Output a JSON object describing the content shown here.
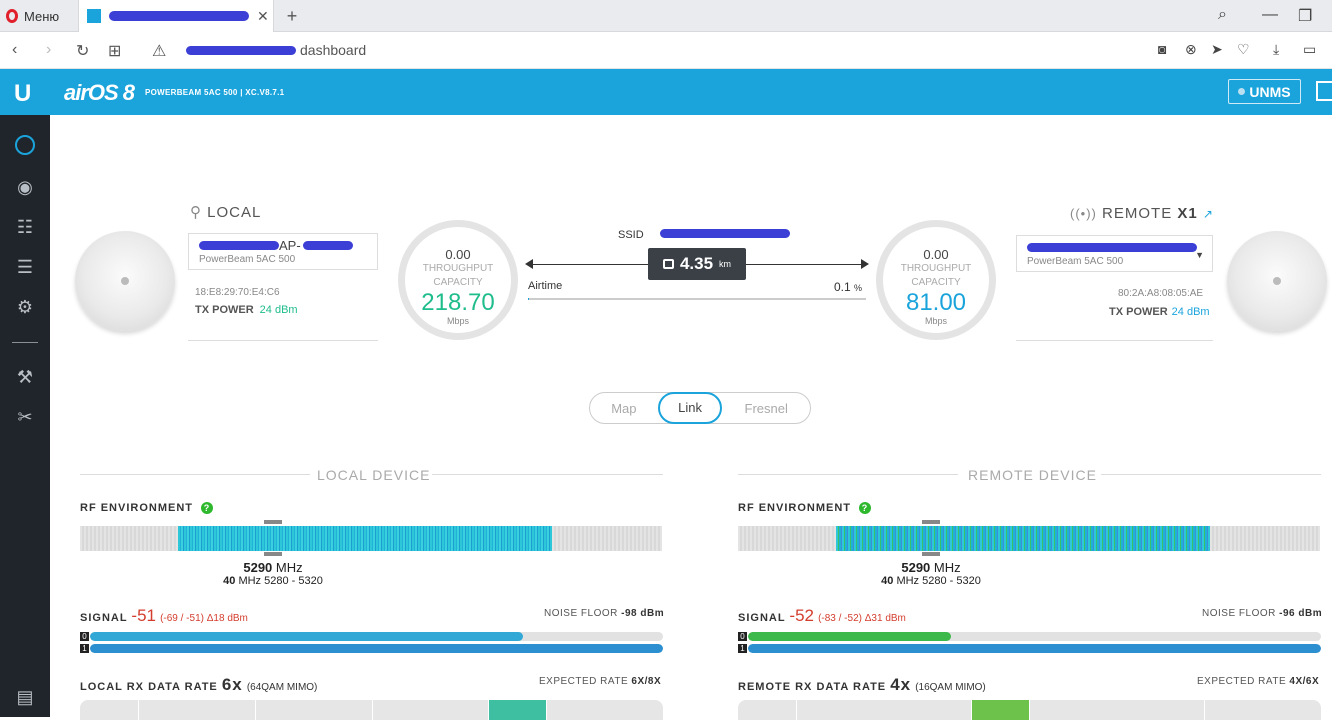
{
  "browser": {
    "menu_label": "Меню",
    "url_suffix": "dashboard"
  },
  "header": {
    "logo": "U",
    "brand": "airOS 8",
    "device_info": "POWERBEAM 5AC 500 | XC.V8.7.1",
    "unms_label": "UNMS"
  },
  "sidebar": {
    "items": [
      "dashboard",
      "wireless",
      "network",
      "services",
      "system",
      "tools",
      "utilities",
      "log"
    ]
  },
  "local": {
    "title": "LOCAL",
    "name": "AP-",
    "model": "PowerBeam 5AC 500",
    "mac": "18:E8:29:70:E4:C6",
    "tx_power_label": "TX POWER",
    "tx_power": "24 dBm"
  },
  "remote": {
    "title": "REMOTE",
    "count": "X1",
    "model": "PowerBeam 5AC 500",
    "mac": "80:2A:A8:08:05:AE",
    "tx_power_label": "TX POWER",
    "tx_power": "24 dBm"
  },
  "local_gauge": {
    "throughput": "0.00",
    "label1": "THROUGHPUT",
    "label2": "CAPACITY",
    "capacity": "218.70",
    "unit": "Mbps"
  },
  "remote_gauge": {
    "throughput": "0.00",
    "label1": "THROUGHPUT",
    "label2": "CAPACITY",
    "capacity": "81.00",
    "unit": "Mbps"
  },
  "link": {
    "ssid_label": "SSID",
    "distance": "4.35",
    "distance_unit": "km",
    "airtime_label": "Airtime",
    "airtime_value": "0.1",
    "airtime_unit": "%",
    "airtime_fraction": 0.001
  },
  "view_toggle": {
    "options": [
      "Map",
      "Link",
      "Fresnel"
    ],
    "selected": "Link"
  },
  "local_device": {
    "section_title": "LOCAL DEVICE",
    "rf_label": "RF ENVIRONMENT",
    "freq": "5290",
    "freq_unit": "MHz",
    "width": "40",
    "width_unit": "MHz",
    "range": "5280 - 5320",
    "signal_label": "SIGNAL",
    "signal": "-51",
    "signal_detail": "(-69 / -51) Δ18 dBm",
    "noise_label": "NOISE FLOOR",
    "noise": "-98 dBm",
    "chains": [
      {
        "idx": "0",
        "level": 0.755,
        "color": "#32a8d6"
      },
      {
        "idx": "1",
        "level": 1.0,
        "color": "#2b8fd0"
      }
    ],
    "rate_label": "LOCAL RX DATA RATE",
    "rate": "6x",
    "rate_detail": "(64QAM MIMO)",
    "expected_label": "EXPECTED RATE",
    "expected": "6X/8X",
    "rate_highlight_color": "#3fbfa2"
  },
  "remote_device": {
    "section_title": "REMOTE DEVICE",
    "rf_label": "RF ENVIRONMENT",
    "freq": "5290",
    "freq_unit": "MHz",
    "width": "40",
    "width_unit": "MHz",
    "range": "5280 - 5320",
    "signal_label": "SIGNAL",
    "signal": "-52",
    "signal_detail": "(-83 / -52) Δ31 dBm",
    "noise_label": "NOISE FLOOR",
    "noise": "-96 dBm",
    "chains": [
      {
        "idx": "0",
        "level": 0.355,
        "color": "#3cb94a"
      },
      {
        "idx": "1",
        "level": 1.0,
        "color": "#2b8fd0"
      }
    ],
    "rate_label": "REMOTE RX DATA RATE",
    "rate": "4x",
    "rate_detail": "(16QAM MIMO)",
    "expected_label": "EXPECTED RATE",
    "expected": "4X/6X",
    "rate_highlight_color": "#6cc24a"
  },
  "colors": {
    "accent": "#1ba4dc",
    "capacity_local": "#1fbc8c",
    "capacity_remote": "#1ba4dc",
    "sidebar": "#20252b",
    "signal_text": "#d43d2d"
  }
}
